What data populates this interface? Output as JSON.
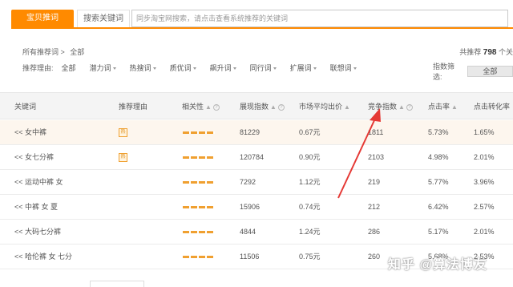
{
  "tabs": {
    "active": "宝贝推词",
    "keywords": "搜索关键词"
  },
  "search": {
    "placeholder": "同步淘宝网搜索，请点击查看系统推荐的关键词"
  },
  "filters": {
    "all_words_label": "所有推荐词 >",
    "all_words_value": "全部",
    "reason_label": "推荐理由:",
    "reasons": [
      "全部",
      "潜力词",
      "热搜词",
      "质优词",
      "飙升词",
      "同行词",
      "扩展词",
      "联想词"
    ]
  },
  "summary": {
    "prefix": "共推荐",
    "count": "798",
    "suffix": "个关"
  },
  "indicator_filter": {
    "label": "指数筛选:",
    "value": "全部"
  },
  "table": {
    "headers": {
      "keyword": "关键词",
      "reason": "推荐理由",
      "relevance": "相关性",
      "impressions": "展现指数",
      "avg_price": "市场平均出价",
      "competition": "竞争指数",
      "ctr": "点击率",
      "cvr": "点击转化率"
    },
    "hot_badge": "热",
    "rows": [
      {
        "keyword": "<< 女中裤",
        "hot": true,
        "impressions": "81229",
        "avg_price": "0.67元",
        "competition": "1811",
        "ctr": "5.73%",
        "cvr": "1.65%"
      },
      {
        "keyword": "<< 女七分裤",
        "hot": true,
        "impressions": "120784",
        "avg_price": "0.90元",
        "competition": "2103",
        "ctr": "4.98%",
        "cvr": "2.01%"
      },
      {
        "keyword": "<< 运动中裤 女",
        "hot": false,
        "impressions": "7292",
        "avg_price": "1.12元",
        "competition": "219",
        "ctr": "5.77%",
        "cvr": "3.96%"
      },
      {
        "keyword": "<< 中裤 女 夏",
        "hot": false,
        "impressions": "15906",
        "avg_price": "0.74元",
        "competition": "212",
        "ctr": "6.42%",
        "cvr": "2.57%"
      },
      {
        "keyword": "<< 大码七分裤",
        "hot": false,
        "impressions": "4844",
        "avg_price": "1.24元",
        "competition": "286",
        "ctr": "5.17%",
        "cvr": "2.01%"
      },
      {
        "keyword": "<< 哈伦裤 女 七分",
        "hot": false,
        "impressions": "11506",
        "avg_price": "0.75元",
        "competition": "260",
        "ctr": "5.68%",
        "cvr": "2.53%"
      }
    ]
  },
  "watermark": "知乎 @算法博友",
  "colors": {
    "accent": "#ff8a00",
    "arrow": "#e53935",
    "header_bg": "#f4f4f4"
  }
}
